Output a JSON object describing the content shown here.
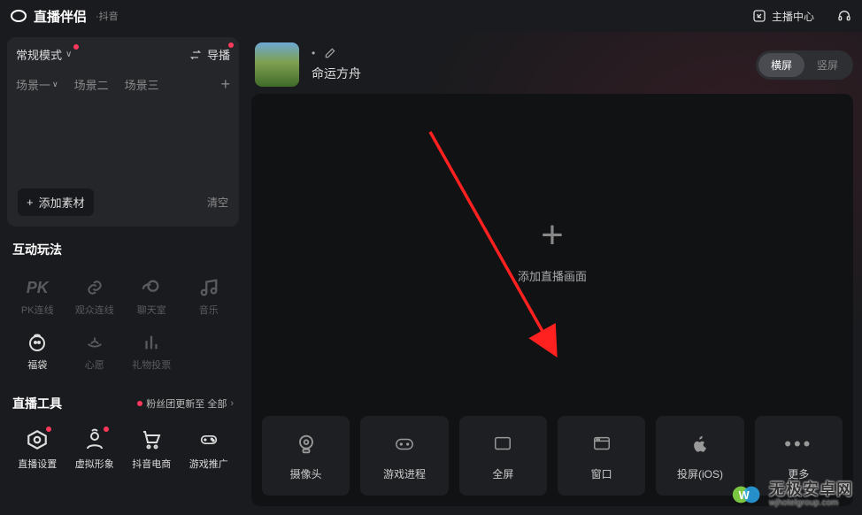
{
  "titlebar": {
    "app_name": "直播伴侣",
    "sub_brand": "·抖音",
    "host_center": "主播中心"
  },
  "sidebar": {
    "mode_label": "常规模式",
    "director_label": "导播",
    "scenes": [
      "场景一",
      "场景二",
      "场景三"
    ],
    "add_material": "添加素材",
    "clear_label": "清空",
    "interact_title": "互动玩法",
    "interact_items": [
      {
        "label": "PK连线",
        "icon": "pk"
      },
      {
        "label": "观众连线",
        "icon": "link"
      },
      {
        "label": "聊天室",
        "icon": "chat"
      },
      {
        "label": "音乐",
        "icon": "music"
      },
      {
        "label": "福袋",
        "icon": "bag"
      },
      {
        "label": "心愿",
        "icon": "wish"
      },
      {
        "label": "礼物投票",
        "icon": "vote"
      }
    ],
    "tools_title": "直播工具",
    "tools_note": "粉丝团更新至 全部",
    "tools_items": [
      {
        "label": "直播设置",
        "icon": "gear"
      },
      {
        "label": "虚拟形象",
        "icon": "avatar"
      },
      {
        "label": "抖音电商",
        "icon": "cart"
      },
      {
        "label": "游戏推广",
        "icon": "gamepad"
      }
    ]
  },
  "content": {
    "status_dot": "•",
    "nickname": "命运方舟",
    "orient": {
      "landscape": "横屏",
      "portrait": "竖屏"
    },
    "canvas_hint": "添加直播画面",
    "sources": [
      {
        "label": "摄像头",
        "icon": "camera"
      },
      {
        "label": "游戏进程",
        "icon": "gamepad"
      },
      {
        "label": "全屏",
        "icon": "fullscreen"
      },
      {
        "label": "窗口",
        "icon": "window"
      },
      {
        "label": "投屏(iOS)",
        "icon": "apple"
      },
      {
        "label": "更多",
        "icon": "more"
      }
    ]
  },
  "watermark": {
    "cn": "无极安卓网",
    "en": "wjhotelgroup.com"
  }
}
